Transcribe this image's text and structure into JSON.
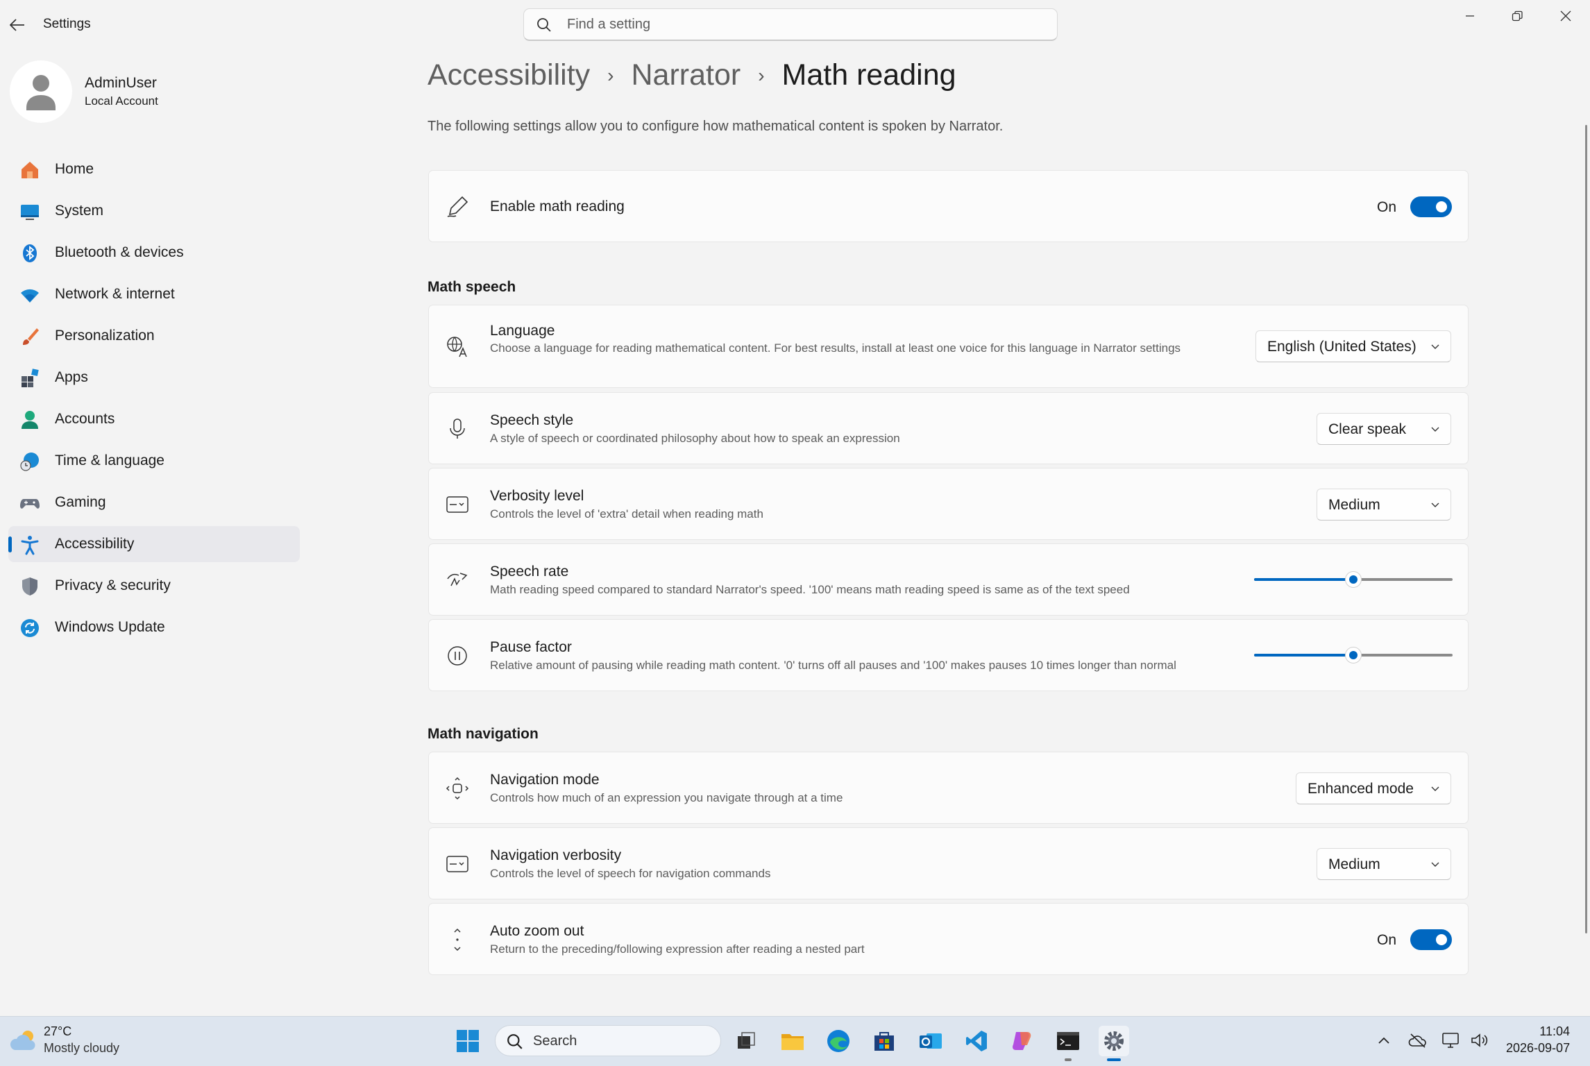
{
  "window": {
    "title": "Settings",
    "search_placeholder": "Find a setting"
  },
  "user": {
    "name": "AdminUser",
    "account_type": "Local Account"
  },
  "sidebar": {
    "items": [
      {
        "label": "Home"
      },
      {
        "label": "System"
      },
      {
        "label": "Bluetooth & devices"
      },
      {
        "label": "Network & internet"
      },
      {
        "label": "Personalization"
      },
      {
        "label": "Apps"
      },
      {
        "label": "Accounts"
      },
      {
        "label": "Time & language"
      },
      {
        "label": "Gaming"
      },
      {
        "label": "Accessibility",
        "active": true
      },
      {
        "label": "Privacy & security"
      },
      {
        "label": "Windows Update"
      }
    ]
  },
  "breadcrumb": {
    "level1": "Accessibility",
    "level2": "Narrator",
    "current": "Math reading",
    "separator": "›"
  },
  "intro": "The following settings allow you to configure how mathematical content is spoken by Narrator.",
  "enable": {
    "title": "Enable math reading",
    "state_label": "On",
    "on": true
  },
  "math_speech": {
    "section_title": "Math speech",
    "language": {
      "title": "Language",
      "desc": "Choose a language for reading mathematical content. For best results, install at least one voice for this language in Narrator settings",
      "value": "English (United States)"
    },
    "speech_style": {
      "title": "Speech style",
      "desc": "A style of speech or coordinated philosophy about how to speak an expression",
      "value": "Clear speak"
    },
    "verbosity": {
      "title": "Verbosity level",
      "desc": "Controls the level of 'extra' detail when reading math",
      "value": "Medium"
    },
    "speech_rate": {
      "title": "Speech rate",
      "desc": "Math reading speed compared to standard Narrator's speed. '100' means math reading speed is same as of the text speed",
      "level": 0.5
    },
    "pause_factor": {
      "title": "Pause factor",
      "desc": "Relative amount of pausing while reading math content. '0' turns off all pauses and '100' makes pauses 10 times longer than normal",
      "level": 0.5
    }
  },
  "math_navigation": {
    "section_title": "Math navigation",
    "navigation_mode": {
      "title": "Navigation mode",
      "desc": "Controls how much of an expression you navigate through at a time",
      "value": "Enhanced mode"
    },
    "navigation_verbosity": {
      "title": "Navigation verbosity",
      "desc": "Controls the level of speech for navigation commands",
      "value": "Medium"
    },
    "auto_zoom": {
      "title": "Auto zoom out",
      "desc": "Return to the preceding/following expression after reading a nested part",
      "state_label": "On",
      "on": true
    }
  },
  "taskbar": {
    "weather_temp": "27°C",
    "weather_desc": "Mostly cloudy",
    "search_label": "Search",
    "time": "11:04",
    "date": "2026-09-07"
  },
  "colors": {
    "accent": "#0067c0",
    "background": "#f3f3f3",
    "card": "#fbfbfb"
  }
}
